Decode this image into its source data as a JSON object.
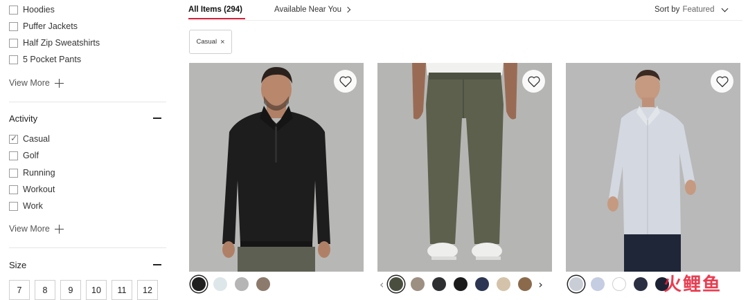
{
  "sidebar": {
    "category_items": [
      {
        "label": "Hoodies",
        "checked": false
      },
      {
        "label": "Puffer Jackets",
        "checked": false
      },
      {
        "label": "Half Zip Sweatshirts",
        "checked": false
      },
      {
        "label": "5 Pocket Pants",
        "checked": false
      }
    ],
    "category_view_more": "View More",
    "activity": {
      "title": "Activity",
      "items": [
        {
          "label": "Casual",
          "checked": true
        },
        {
          "label": "Golf",
          "checked": false
        },
        {
          "label": "Running",
          "checked": false
        },
        {
          "label": "Workout",
          "checked": false
        },
        {
          "label": "Work",
          "checked": false
        }
      ],
      "view_more": "View More"
    },
    "size": {
      "title": "Size",
      "options": [
        "7",
        "8",
        "9",
        "10",
        "11",
        "12"
      ]
    }
  },
  "topbar": {
    "tab_all": "All Items (294)",
    "tab_near": "Available Near You",
    "sort_label": "Sort by",
    "sort_value": "Featured"
  },
  "active_filter": {
    "label": "Casual",
    "remove_symbol": "×"
  },
  "products": [
    {
      "image": "man-black-half-zip-sweatshirt",
      "swatches": [
        "#1f1f1f",
        "#dde7ea",
        "#b5b5b5",
        "#8c7a6c"
      ],
      "selected_swatch": 0
    },
    {
      "image": "olive-trousers",
      "swatches": [
        "#4a4e3f",
        "#9d8f82",
        "#2e2f31",
        "#1b1b1b",
        "#2c3552",
        "#d4c3aa",
        "#8b6a4c"
      ],
      "selected_swatch": 0
    },
    {
      "image": "man-light-blue-button-shirt",
      "swatches": [
        "#c9cdd6",
        "#c5cde3",
        "#ffffff",
        "#2a3042",
        "#1c2233"
      ],
      "selected_swatch": 0
    }
  ],
  "watermark": "火鲤鱼",
  "colors": {
    "accent": "#d31f3a",
    "photo_bg": "#b6b8b7"
  }
}
